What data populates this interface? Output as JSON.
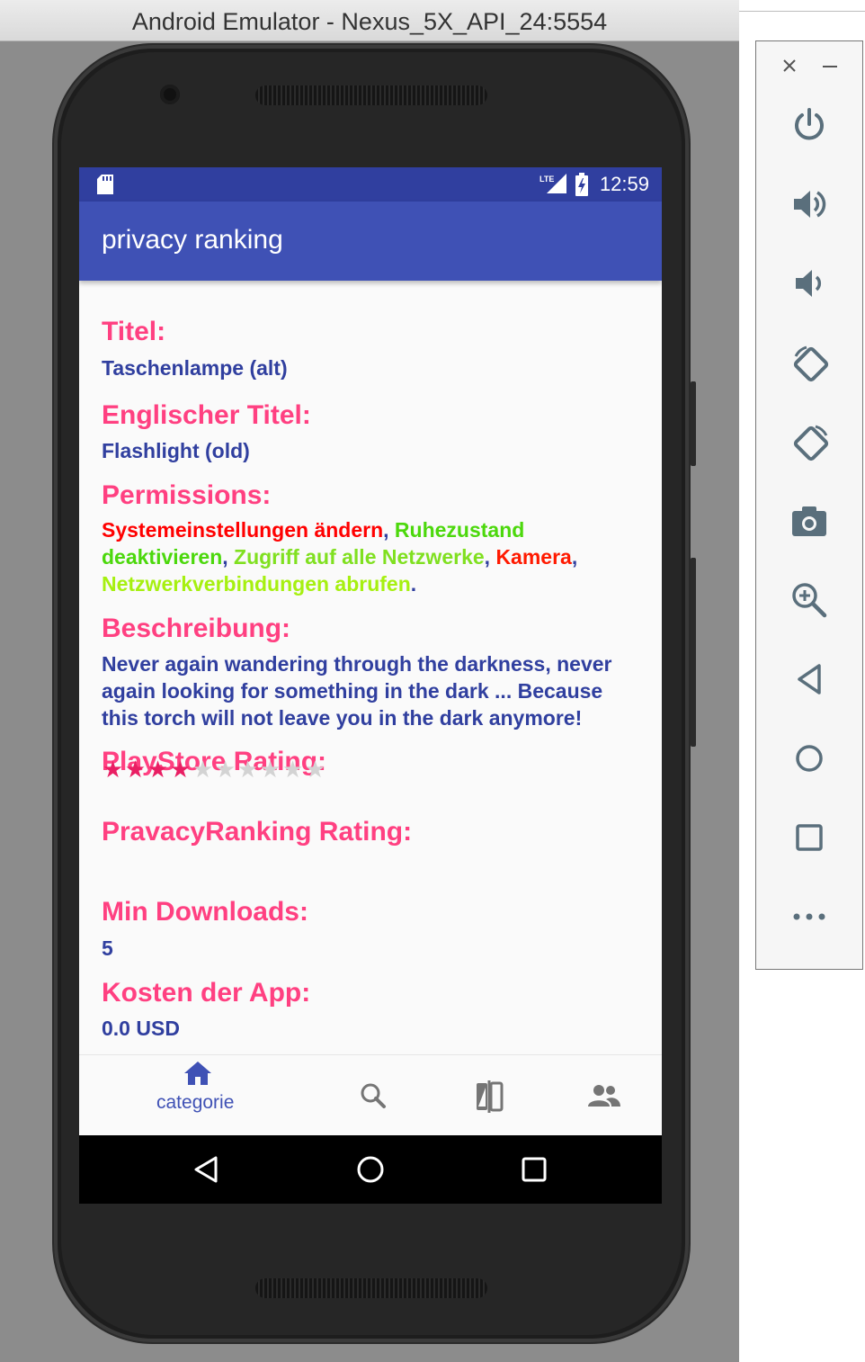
{
  "window": {
    "title": "Android Emulator - Nexus_5X_API_24:5554"
  },
  "status_bar": {
    "network": "LTE",
    "time": "12:59"
  },
  "app_bar": {
    "title": "privacy ranking"
  },
  "details": {
    "title_label": "Titel:",
    "title_value": "Taschenlampe (alt)",
    "english_title_label": "Englischer Titel:",
    "english_title_value": "Flashlight (old)",
    "permissions_label": "Permissions:",
    "permissions": [
      {
        "text": "Systemeinstellungen ändern",
        "color": "#ff0000"
      },
      {
        "text": "Ruhezustand deaktivieren",
        "color": "#4cd80c"
      },
      {
        "text": "Zugriff auf alle Netzwerke",
        "color": "#80e020"
      },
      {
        "text": "Kamera",
        "color": "#ff1a00"
      },
      {
        "text": "Netzwerkverbindungen abrufen",
        "color": "#a6f010"
      }
    ],
    "description_label": "Beschreibung:",
    "description_value": "Never again wandering through the darkness, never again looking for something in the dark ... Because this torch will not leave you in the dark anymore!",
    "playstore_rating_label": "PlayStore Rating:",
    "playstore_rating": {
      "filled": 4,
      "total": 10
    },
    "privacy_rating_label": "PravacyRanking Rating:",
    "min_downloads_label": "Min Downloads:",
    "min_downloads_value": "5",
    "cost_label": "Kosten der App:",
    "cost_value": "0.0 USD"
  },
  "bottom_nav": {
    "active_label": "categorie",
    "items": [
      "home-icon",
      "search-icon",
      "compare-icon",
      "people-icon"
    ]
  },
  "colors": {
    "primary": "#3f51b5",
    "primary_dark": "#303f9f",
    "accent": "#ff4081"
  }
}
